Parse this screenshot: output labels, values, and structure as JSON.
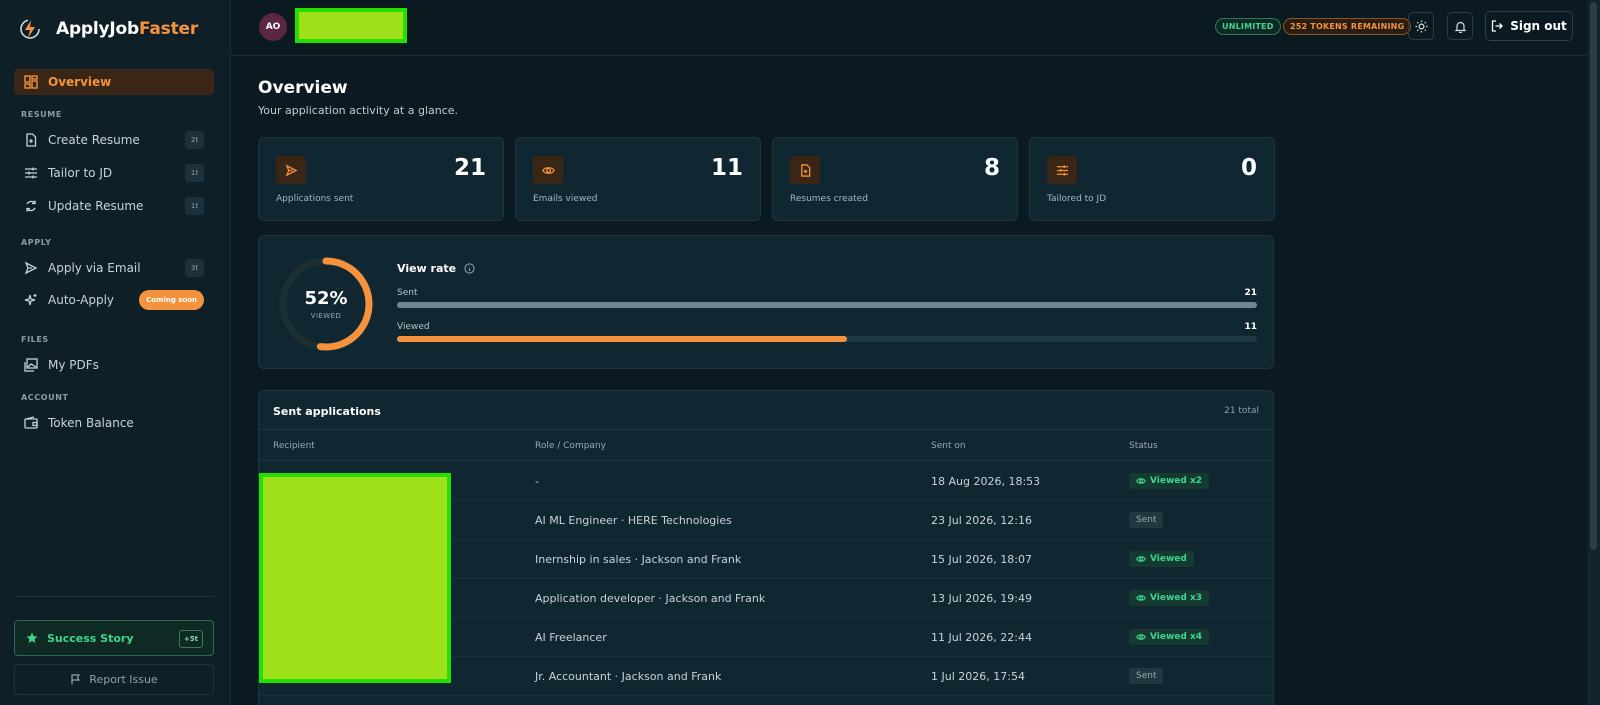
{
  "app": {
    "name_prefix": "ApplyJob",
    "name_accent": "Faster"
  },
  "colors": {
    "accent": "#f5923e",
    "success": "#3fd58e",
    "background": "#0b1a21",
    "card": "#102630"
  },
  "sidebar": {
    "overview_label": "Overview",
    "sections": {
      "resume": "RESUME",
      "apply": "APPLY",
      "files": "FILES",
      "account": "ACCOUNT"
    },
    "items": {
      "create_resume": {
        "label": "Create Resume",
        "badge": "2t",
        "icon": "file-plus-icon"
      },
      "tailor_jd": {
        "label": "Tailor to JD",
        "badge": "1t",
        "icon": "sliders-icon"
      },
      "update_resume": {
        "label": "Update Resume",
        "badge": "1t",
        "icon": "refresh-icon"
      },
      "apply_email": {
        "label": "Apply via Email",
        "badge": "3t",
        "icon": "send-icon"
      },
      "auto_apply": {
        "label": "Auto-Apply",
        "badge": "Coming soon",
        "icon": "sparkle-icon"
      },
      "my_pdfs": {
        "label": "My PDFs",
        "icon": "image-stack-icon"
      },
      "token_balance": {
        "label": "Token Balance",
        "icon": "wallet-icon"
      }
    },
    "success_story": {
      "label": "Success Story",
      "badge": "+5t"
    },
    "report_issue": {
      "label": "Report Issue"
    }
  },
  "header": {
    "avatar_initials": "AO",
    "plan_tag": "UNLIMITED",
    "tokens_tag": "252 TOKENS REMAINING",
    "sign_out": "Sign out"
  },
  "overview": {
    "title": "Overview",
    "subtitle": "Your application activity at a glance.",
    "stats": [
      {
        "value": "21",
        "label": "Applications sent",
        "icon": "send-icon"
      },
      {
        "value": "11",
        "label": "Emails viewed",
        "icon": "eye-icon"
      },
      {
        "value": "8",
        "label": "Resumes created",
        "icon": "file-plus-icon"
      },
      {
        "value": "0",
        "label": "Tailored to JD",
        "icon": "sliders-icon"
      }
    ]
  },
  "view_rate": {
    "percent_label": "52%",
    "percent": 52,
    "caption": "VIEWED",
    "title": "View rate",
    "sent_label": "Sent",
    "sent_value": "21",
    "viewed_label": "Viewed",
    "viewed_value": "11",
    "sent_count": 21,
    "viewed_count": 11
  },
  "applications": {
    "title": "Sent applications",
    "total": "21 total",
    "columns": [
      "Recipient",
      "Role / Company",
      "Sent on",
      "Status"
    ],
    "rows": [
      {
        "role": "-",
        "sent_on": "18 Aug 2026, 18:53",
        "status": "Viewed x2",
        "viewed": true
      },
      {
        "role": "AI ML Engineer · HERE Technologies",
        "sent_on": "23 Jul 2026, 12:16",
        "status": "Sent",
        "viewed": false
      },
      {
        "role": "Inernship in sales · Jackson and Frank",
        "sent_on": "15 Jul 2026, 18:07",
        "status": "Viewed",
        "viewed": true
      },
      {
        "role": "Application developer · Jackson and Frank",
        "sent_on": "13 Jul 2026, 19:49",
        "status": "Viewed x3",
        "viewed": true
      },
      {
        "role": "AI Freelancer",
        "sent_on": "11 Jul 2026, 22:44",
        "status": "Viewed x4",
        "viewed": true
      },
      {
        "role": "Jr. Accountant · Jackson and Frank",
        "sent_on": "1 Jul 2026, 17:54",
        "status": "Sent",
        "viewed": false
      }
    ]
  }
}
